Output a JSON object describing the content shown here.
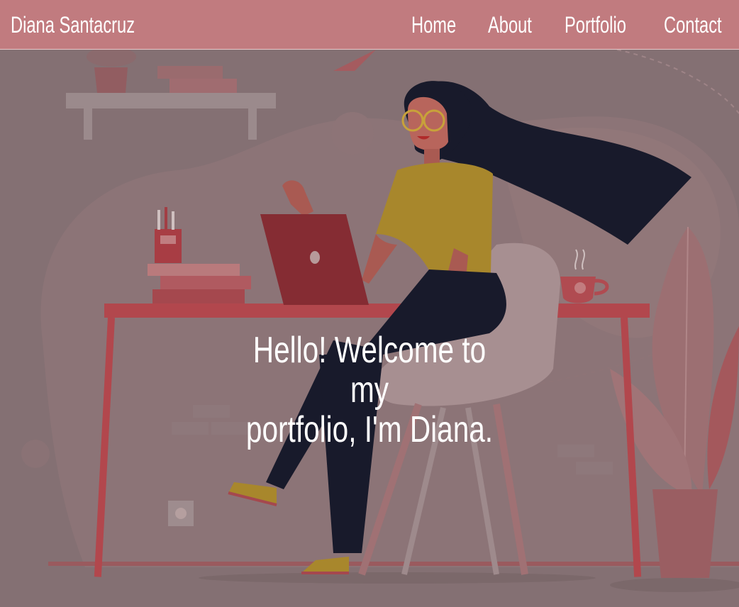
{
  "navbar": {
    "brand": "Diana Santacruz",
    "links": [
      "Home",
      "About",
      "Portfolio",
      "Contact"
    ]
  },
  "hero": {
    "heading_line1": "Hello! Welcome to my",
    "heading_line2": "portfolio, I'm Diana."
  },
  "colors": {
    "navbar_bg": "#c17b7f",
    "overlay_bg": "#847073",
    "heading_text": "#ffffff"
  }
}
